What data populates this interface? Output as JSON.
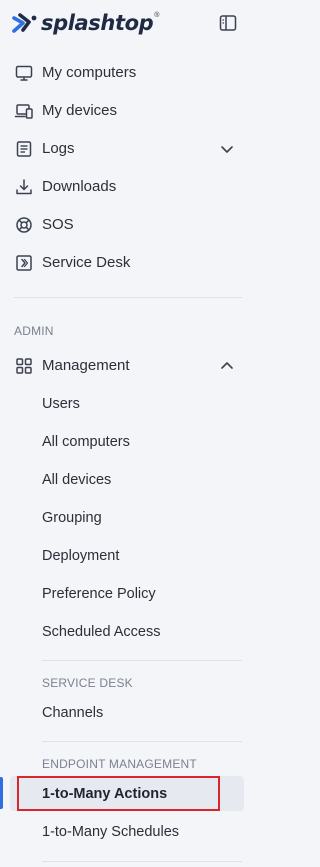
{
  "brand": {
    "name": "splashtop",
    "trademark": "®",
    "accent_color": "#2f6fe0"
  },
  "nav": {
    "items": [
      {
        "label": "My computers",
        "icon": "monitor-icon"
      },
      {
        "label": "My devices",
        "icon": "devices-icon"
      },
      {
        "label": "Logs",
        "icon": "log-icon",
        "expanded": false
      },
      {
        "label": "Downloads",
        "icon": "download-icon"
      },
      {
        "label": "SOS",
        "icon": "sos-icon"
      },
      {
        "label": "Service Desk",
        "icon": "service-desk-icon"
      }
    ]
  },
  "admin": {
    "heading": "ADMIN",
    "management": {
      "label": "Management",
      "icon": "grid-icon",
      "expanded": true
    },
    "items": [
      "Users",
      "All computers",
      "All devices",
      "Grouping",
      "Deployment",
      "Preference Policy",
      "Scheduled Access"
    ],
    "service_desk": {
      "heading": "SERVICE DESK",
      "items": [
        "Channels"
      ]
    },
    "endpoint": {
      "heading": "ENDPOINT MANAGEMENT",
      "items": [
        "1-to-Many Actions",
        "1-to-Many Schedules"
      ],
      "active": "1-to-Many Actions",
      "highlight_color": "#d9262c"
    }
  }
}
